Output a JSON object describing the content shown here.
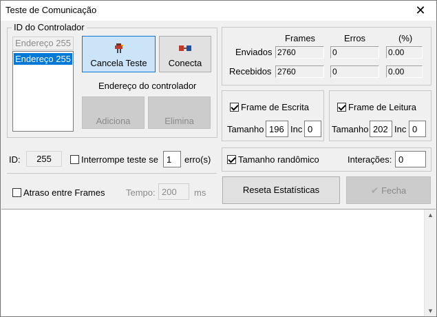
{
  "window": {
    "title": "Teste de Comunicação",
    "close_glyph": "✕"
  },
  "controller": {
    "group_label": "ID do Controlador",
    "search_value": "Endereço 255",
    "list_items": [
      "Endereço 255"
    ],
    "cancel_button": "Cancela Teste",
    "connect_button": "Conecta",
    "address_label": "Endereço do controlador",
    "add_button": "Adiciona",
    "remove_button": "Elimina"
  },
  "stats": {
    "headers": {
      "frames": "Frames",
      "errors": "Erros",
      "percent": "(%)"
    },
    "rows": [
      {
        "label": "Enviados",
        "frames": "2760",
        "errors": "0",
        "percent": "0.00"
      },
      {
        "label": "Recebidos",
        "frames": "2760",
        "errors": "0",
        "percent": "0.00"
      }
    ]
  },
  "write_frame": {
    "label": "Frame de Escrita",
    "checked": true,
    "size_label": "Tamanho",
    "size": "196",
    "inc_label": "Inc",
    "inc": "0"
  },
  "read_frame": {
    "label": "Frame de Leitura",
    "checked": true,
    "size_label": "Tamanho",
    "size": "202",
    "inc_label": "Inc",
    "inc": "0"
  },
  "id_row": {
    "label": "ID:",
    "value": "255"
  },
  "interrupt": {
    "label": "Interrompe teste se",
    "checked": false,
    "value": "1",
    "suffix": "erro(s)"
  },
  "random_size": {
    "label": "Tamanho randômico",
    "checked": true
  },
  "iterations": {
    "label": "Interações:",
    "value": "0"
  },
  "delay": {
    "label": "Atraso entre Frames",
    "checked": false,
    "time_label": "Tempo:",
    "time_value": "200",
    "unit": "ms"
  },
  "actions": {
    "reset_button": "Reseta Estatísticas",
    "close_button": "Fecha"
  },
  "icons": {
    "cancel": "stop-test-icon",
    "connect": "connect-icon",
    "close": "checkmark-icon"
  },
  "colors": {
    "selection": "#0078d7",
    "active_button": "#cce4f7"
  }
}
